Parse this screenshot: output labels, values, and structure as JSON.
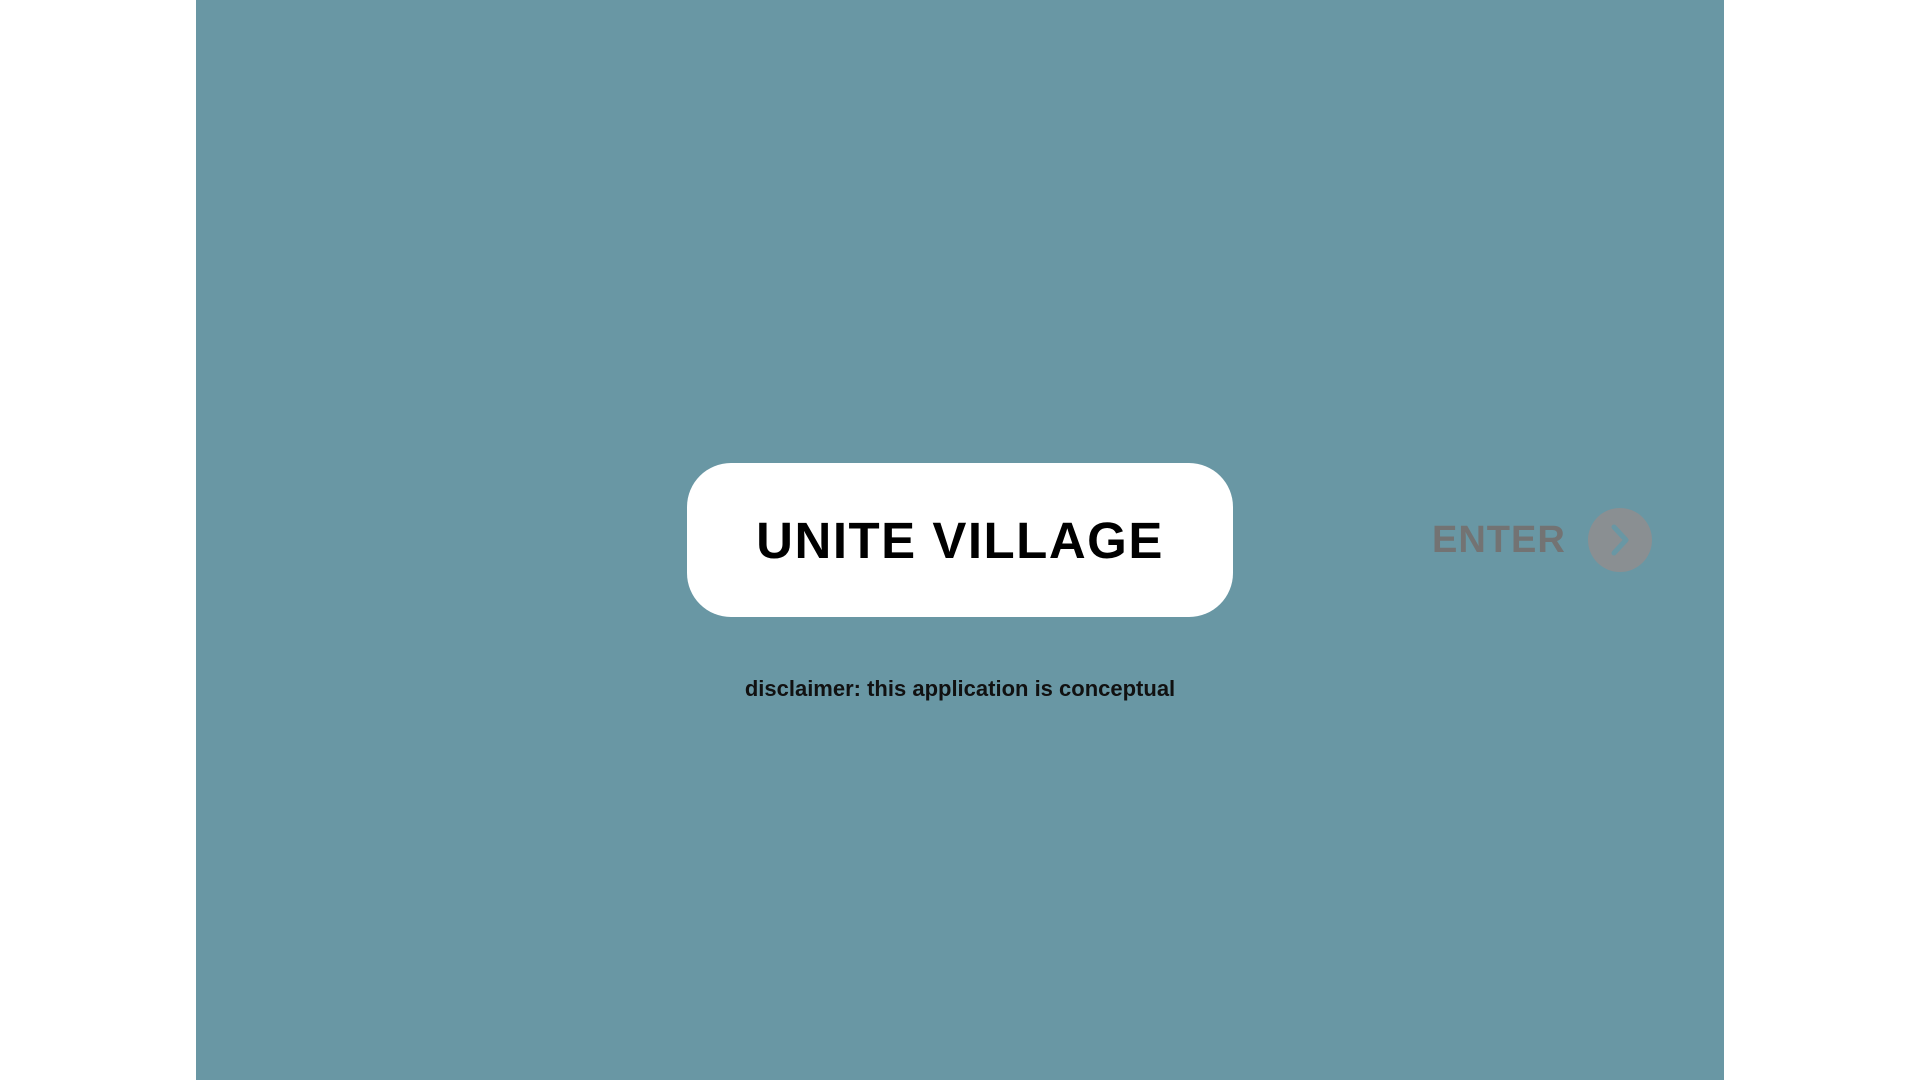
{
  "app": {
    "title": "UNITE VILLAGE",
    "disclaimer": "disclaimer: this application is conceptual"
  },
  "enter_button": {
    "label": "ENTER",
    "icon": "chevron-right-icon"
  },
  "colors": {
    "stage_background": "#6997a4",
    "title_pill": "#ffffff",
    "enter_text": "#737373",
    "enter_circle": "#8a8f92"
  }
}
